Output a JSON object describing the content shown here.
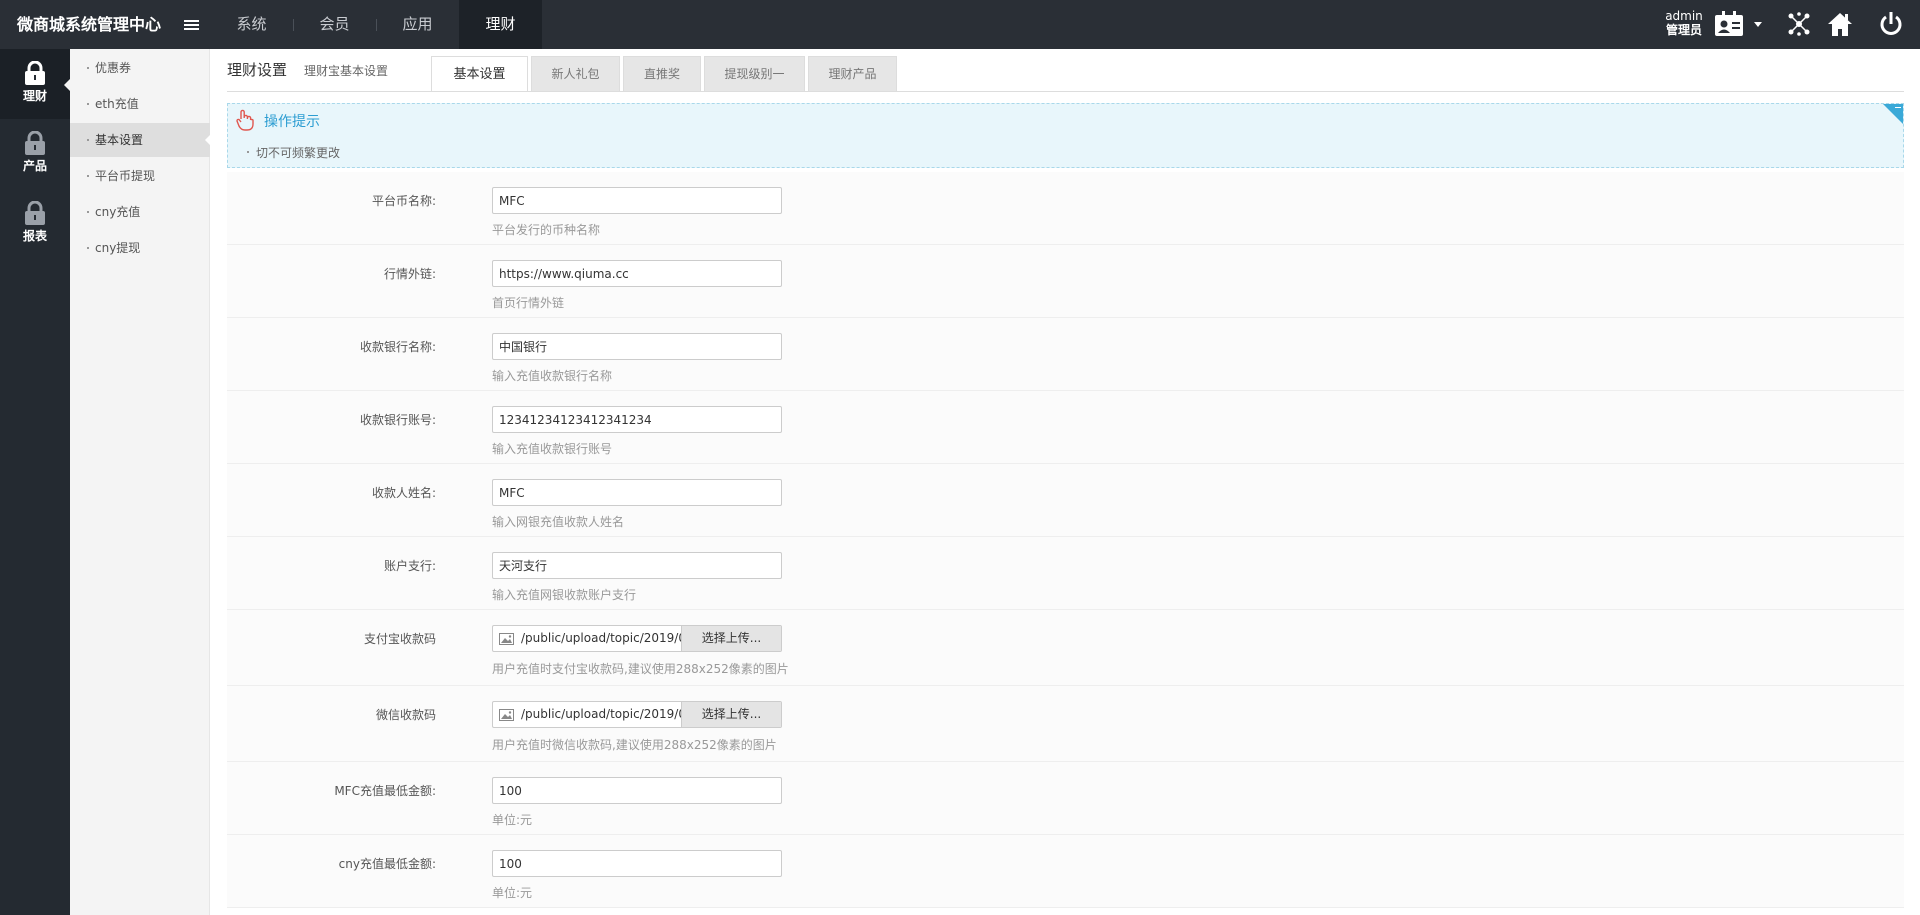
{
  "app": {
    "title": "微商城系统管理中心"
  },
  "top_nav": [
    {
      "label": "系统"
    },
    {
      "label": "会员"
    },
    {
      "label": "应用"
    },
    {
      "label": "理财"
    }
  ],
  "user": {
    "name": "admin",
    "role": "管理员"
  },
  "left_nav": [
    {
      "label": "理财",
      "icon": "lock-icon"
    },
    {
      "label": "产品",
      "icon": "lock-icon"
    },
    {
      "label": "报表",
      "icon": "lock-icon"
    }
  ],
  "submenu": [
    {
      "label": "优惠券"
    },
    {
      "label": "eth充值"
    },
    {
      "label": "基本设置"
    },
    {
      "label": "平台币提现"
    },
    {
      "label": "cny充值"
    },
    {
      "label": "cny提现"
    }
  ],
  "page": {
    "title": "理财设置",
    "subtitle": "理财宝基本设置"
  },
  "tabs": [
    {
      "label": "基本设置"
    },
    {
      "label": "新人礼包"
    },
    {
      "label": "直推奖"
    },
    {
      "label": "提现级别一"
    },
    {
      "label": "理财产品"
    }
  ],
  "tip": {
    "title": "操作提示",
    "line": "切不可频繁更改"
  },
  "form": {
    "coin_name": {
      "label": "平台币名称:",
      "value": "MFC",
      "hint": "平台发行的币种名称"
    },
    "market_link": {
      "label": "行情外链:",
      "value": "https://www.qiuma.cc",
      "hint": "首页行情外链"
    },
    "bank_name": {
      "label": "收款银行名称:",
      "value": "中国银行",
      "hint": "输入充值收款银行名称"
    },
    "bank_account": {
      "label": "收款银行账号:",
      "value": "12341234123412341234",
      "hint": "输入充值收款银行账号"
    },
    "payee_name": {
      "label": "收款人姓名:",
      "value": "MFC",
      "hint": "输入网银充值收款人姓名"
    },
    "branch": {
      "label": "账户支行:",
      "value": "天河支行",
      "hint": "输入充值网银收款账户支行"
    },
    "alipay_qr": {
      "label": "支付宝收款码",
      "path": "/public/upload/topic/2019/0",
      "button": "选择上传...",
      "hint": "用户充值时支付宝收款码,建议使用288x252像素的图片"
    },
    "wechat_qr": {
      "label": "微信收款码",
      "path": "/public/upload/topic/2019/0",
      "button": "选择上传...",
      "hint": "用户充值时微信收款码,建议使用288x252像素的图片"
    },
    "mfc_min": {
      "label": "MFC充值最低金额:",
      "value": "100",
      "hint": "单位:元"
    },
    "cny_min": {
      "label": "cny充值最低金额:",
      "value": "100",
      "hint": "单位:元"
    }
  },
  "colors": {
    "topbar": "#2a2f36",
    "leftnav": "#242a31",
    "accent": "#2c9dd2"
  }
}
